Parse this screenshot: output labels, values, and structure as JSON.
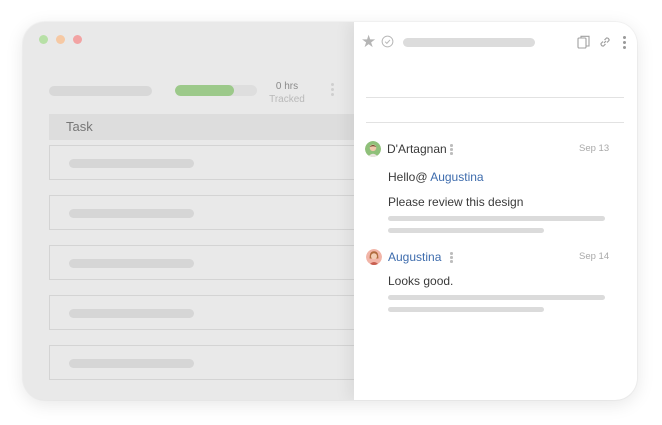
{
  "colors": {
    "dot_green": "#b7e0a6",
    "dot_orange": "#f6c9a4",
    "dot_red": "#f2a3a3",
    "progress_fill": "#9cc98a",
    "mention_blue": "#3e6cad",
    "author_text": "#3a3a3a"
  },
  "toolbar": {
    "progress_value": 0.72,
    "tracked_hours": "0 hrs",
    "tracked_label": "Tracked"
  },
  "table": {
    "header": "Task",
    "rows": 5
  },
  "panel": {
    "icons": [
      "star-icon",
      "check-circle-icon",
      "copy-icon",
      "link-icon",
      "more-vertical-icon"
    ]
  },
  "comments": [
    {
      "author": "D'Artagnan",
      "date": "Sep 13",
      "greeting": "Hello@",
      "mention": "Augustina",
      "message": "Please review this design"
    },
    {
      "author": "Augustina",
      "date": "Sep 14",
      "message": "Looks good."
    }
  ]
}
